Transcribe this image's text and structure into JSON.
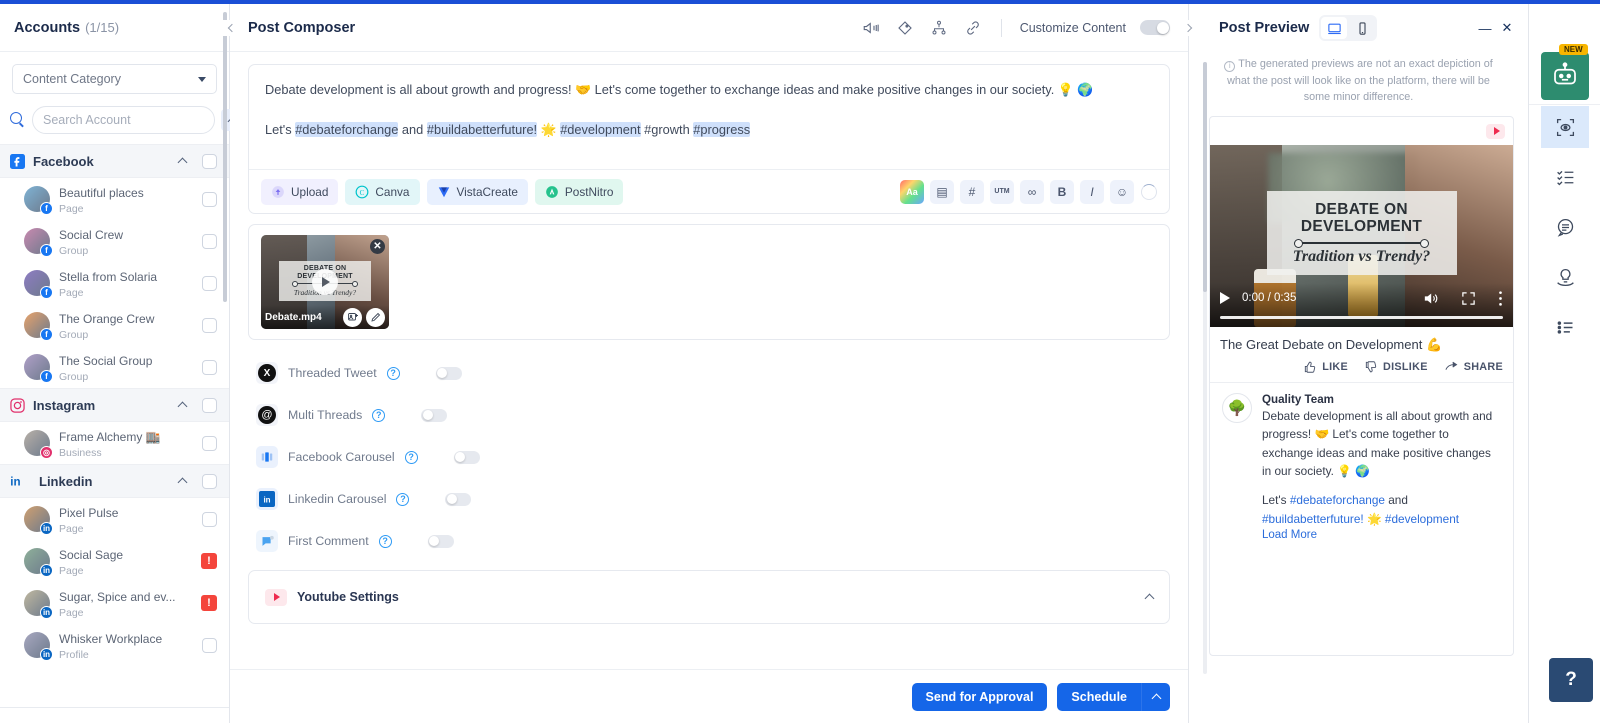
{
  "sidebar": {
    "title": "Accounts",
    "count": "(1/15)",
    "content_category_label": "Content Category",
    "search_placeholder": "Search Account",
    "groups": [
      {
        "name": "Facebook",
        "icon": "facebook-icon",
        "color": "#1877f2",
        "accounts": [
          {
            "name": "Beautiful places",
            "type": "Page",
            "badge": "facebook",
            "status": "checkbox"
          },
          {
            "name": "Social Crew",
            "type": "Group",
            "badge": "facebook",
            "status": "checkbox"
          },
          {
            "name": "Stella from Solaria",
            "type": "Page",
            "badge": "facebook",
            "status": "checkbox"
          },
          {
            "name": "The Orange Crew",
            "type": "Group",
            "badge": "facebook",
            "status": "checkbox"
          },
          {
            "name": "The Social Group",
            "type": "Group",
            "badge": "facebook",
            "status": "checkbox"
          }
        ]
      },
      {
        "name": "Instagram",
        "icon": "instagram-icon",
        "color": "#e1306c",
        "accounts": [
          {
            "name": "Frame Alchemy 🏬",
            "type": "Business",
            "badge": "instagram",
            "status": "checkbox"
          }
        ]
      },
      {
        "name": "Linkedin",
        "icon": "linkedin-icon",
        "color": "#0a66c2",
        "accounts": [
          {
            "name": "Pixel Pulse",
            "type": "Page",
            "badge": "linkedin",
            "status": "checkbox"
          },
          {
            "name": "Social Sage",
            "type": "Page",
            "badge": "linkedin",
            "status": "warning"
          },
          {
            "name": "Sugar, Spice and ev...",
            "type": "Page",
            "badge": "linkedin",
            "status": "warning"
          },
          {
            "name": "Whisker Workplace",
            "type": "Profile",
            "badge": "linkedin",
            "status": "checkbox"
          }
        ]
      }
    ]
  },
  "composer": {
    "title": "Post Composer",
    "header_icons": [
      "megaphone-icon",
      "tag-icon",
      "audience-icon",
      "link-icon"
    ],
    "customize_label": "Customize Content",
    "customize_on": false,
    "editor": {
      "line1_a": "Debate development is all about growth and progress! ",
      "emoji1": "🤝",
      "line1_b": " Let's come together to exchange ideas and make positive changes in our society. ",
      "emoji2": "💡",
      "emoji3": "🌍",
      "line2_prefix": "Let's ",
      "tag1": "#debateforchange",
      "line2_and": " and ",
      "tag2": "#buildabetterfuture!",
      "emoji4": "🌟",
      "tag3": "#development",
      "tag4": "#growth",
      "tag5": "#progress"
    },
    "source_chips": [
      {
        "label": "Upload",
        "icon": "upload-icon",
        "bg": "#f0f0fd",
        "color": "#8b7ff0"
      },
      {
        "label": "Canva",
        "icon": "canva-icon",
        "bg": "#e4f7f8",
        "color": "#00c4cc"
      },
      {
        "label": "VistaCreate",
        "icon": "vistacreate-icon",
        "bg": "#e9f1fe",
        "color": "#2d6bf5"
      },
      {
        "label": "PostNitro",
        "icon": "postnitro-icon",
        "bg": "#e1f7ee",
        "color": "#1bbd86"
      }
    ],
    "format_buttons": [
      {
        "name": "ai-text-icon",
        "glyph": "Aa"
      },
      {
        "name": "save-draft-icon",
        "glyph": "▤"
      },
      {
        "name": "hashtag-icon",
        "glyph": "#"
      },
      {
        "name": "utm-icon",
        "glyph": "UTM"
      },
      {
        "name": "shorten-link-icon",
        "glyph": "∞"
      },
      {
        "name": "bold-icon",
        "glyph": "B"
      },
      {
        "name": "italic-icon",
        "glyph": "I"
      },
      {
        "name": "emoji-icon",
        "glyph": "☺"
      }
    ],
    "media": {
      "filename": "Debate.mp4",
      "overlay_line1": "DEBATE ON",
      "overlay_line2": "DEVELOPMENT",
      "overlay_sub": "Tradition vs Trendy?"
    },
    "options": [
      {
        "label": "Threaded Tweet",
        "icon": "x-twitter-icon",
        "enabled": false
      },
      {
        "label": "Multi Threads",
        "icon": "threads-icon",
        "enabled": false
      },
      {
        "label": "Facebook Carousel",
        "icon": "facebook-carousel-icon",
        "enabled": false
      },
      {
        "label": "Linkedin Carousel",
        "icon": "linkedin-carousel-icon",
        "enabled": false
      },
      {
        "label": "First Comment",
        "icon": "first-comment-icon",
        "enabled": false
      }
    ],
    "youtube_settings_label": "Youtube Settings",
    "footer": {
      "approval_label": "Send for Approval",
      "schedule_label": "Schedule"
    }
  },
  "preview": {
    "title": "Post Preview",
    "device_tabs": [
      "desktop-icon",
      "mobile-icon"
    ],
    "active_device": "desktop",
    "note": "The generated previews are not an exact depiction of what the post will look like on the platform, there will be some minor difference.",
    "video": {
      "line1": "DEBATE ON",
      "line2": "DEVELOPMENT",
      "sub": "Tradition vs Trendy?",
      "time": "0:00 / 0:35"
    },
    "post_title": "The Great Debate on Development 💪",
    "actions": [
      {
        "label": "LIKE",
        "icon": "thumbs-up-icon"
      },
      {
        "label": "DISLIKE",
        "icon": "thumbs-down-icon"
      },
      {
        "label": "SHARE",
        "icon": "share-icon"
      }
    ],
    "comment": {
      "author": "Quality Team",
      "avatar": "🌳",
      "body": "Debate development is all about growth and progress! 🤝 Let's come together to exchange ideas and make positive changes in our society. 💡 🌍",
      "tag_prefix": "Let's ",
      "tag1": "#debateforchange",
      "tag_and": " and ",
      "tag2": "#buildabetterfuture!",
      "tag_emoji": "🌟",
      "tag3": "#development",
      "load_more": "Load More"
    }
  },
  "rail": {
    "new_badge": "NEW",
    "items": [
      "ai-assistant-icon",
      "preview-eye-icon",
      "checklist-icon",
      "notes-icon",
      "ideas-icon",
      "list-icon"
    ],
    "help_glyph": "?"
  },
  "window": {
    "minimize": "—",
    "close": "✕"
  },
  "colors": {
    "accent": "#1566e8",
    "topbar": "#1a4fd6",
    "warning": "#f4453c",
    "ai": "#2d8c6f"
  }
}
